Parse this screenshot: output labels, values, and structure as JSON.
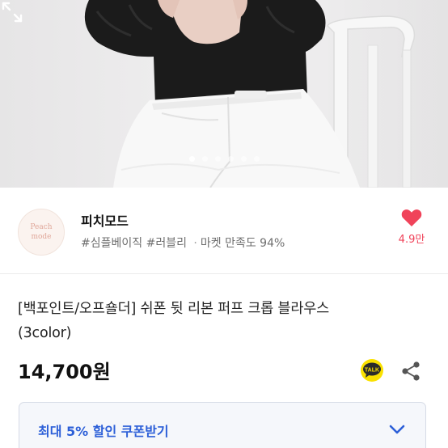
{
  "carousel": {
    "total": 6,
    "active": 0
  },
  "seller": {
    "logo_text": [
      "Peach",
      "mode"
    ],
    "name": "피치모드",
    "tag1": "#심플베이직",
    "tag2": "#러블리",
    "separator": "·",
    "satisfaction": "마켓 만족도 94%",
    "like_count": "4.9만"
  },
  "product": {
    "title_line1": "[백포인트/오프숄더] 쉬폰 뒷 리본 퍼프 크롭 블라우스",
    "title_line2": "(3color)",
    "price": "14,700원"
  },
  "coupon": {
    "label": "최대 5% 할인 쿠폰받기"
  },
  "icons": {
    "expand": "expand-icon",
    "heart": "heart-icon",
    "kakao": "kakaotalk-icon",
    "kakao_text": "TALK",
    "share": "share-icon",
    "chevron": "chevron-down-icon"
  },
  "colors": {
    "heart": "#f0435a",
    "coupon_text": "#2c5fd8",
    "kakao_bubble": "#2b2b2b",
    "kakao_circle": "#fae100"
  }
}
